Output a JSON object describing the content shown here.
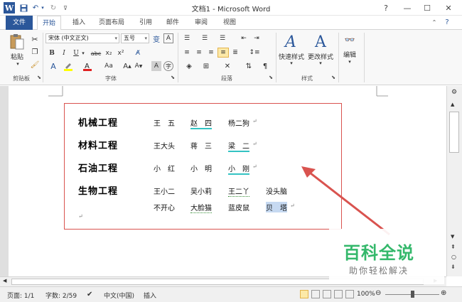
{
  "window": {
    "title": "文档1 - Microsoft Word",
    "help_icon": "?",
    "minimize_icon": "—",
    "restore_icon": "☐",
    "close_icon": "✕"
  },
  "tabs": [
    {
      "label": "文件"
    },
    {
      "label": "开始"
    },
    {
      "label": "插入"
    },
    {
      "label": "页面布局"
    },
    {
      "label": "引用"
    },
    {
      "label": "邮件"
    },
    {
      "label": "审阅"
    },
    {
      "label": "视图"
    }
  ],
  "ribbon": {
    "clipboard": {
      "paste_label": "粘贴",
      "group_label": "剪贴板"
    },
    "font": {
      "font_name": "宋体 (中文正文)",
      "font_size": "五号",
      "group_label": "字体"
    },
    "paragraph": {
      "group_label": "段落"
    },
    "styles": {
      "quick_styles_label": "快速样式",
      "change_styles_label": "更改样式",
      "group_label": "样式"
    },
    "editing": {
      "edit_label": "编辑"
    }
  },
  "document": {
    "rows": [
      {
        "dept": "机械工程",
        "names": [
          "王　五",
          "赵　四",
          "杨二狗"
        ]
      },
      {
        "dept": "材料工程",
        "names": [
          "王大头",
          "蒋　三",
          "梁　二"
        ]
      },
      {
        "dept": "石油工程",
        "names": [
          "小　红",
          "小　明",
          "小　刚"
        ]
      },
      {
        "dept": "生物工程",
        "names": [
          "王小二",
          "吴小莉",
          "王二丫",
          "没头脑"
        ]
      },
      {
        "dept": "",
        "names": [
          "不开心",
          "大脸猫",
          "蓝皮鼠",
          "贝　塔"
        ]
      }
    ],
    "paragraph_mark": "↵"
  },
  "watermark": {
    "title": "百科全说",
    "subtitle": "助你轻松解决"
  },
  "status": {
    "page": "页面: 1/1",
    "words": "字数: 2/59",
    "language": "中文(中国)",
    "mode": "插入",
    "zoom": "100%",
    "zoom_level_fraction": 0.5
  },
  "colors": {
    "accent": "#2b579a",
    "annotation": "#d9534f",
    "watermark": "#34b86b"
  }
}
